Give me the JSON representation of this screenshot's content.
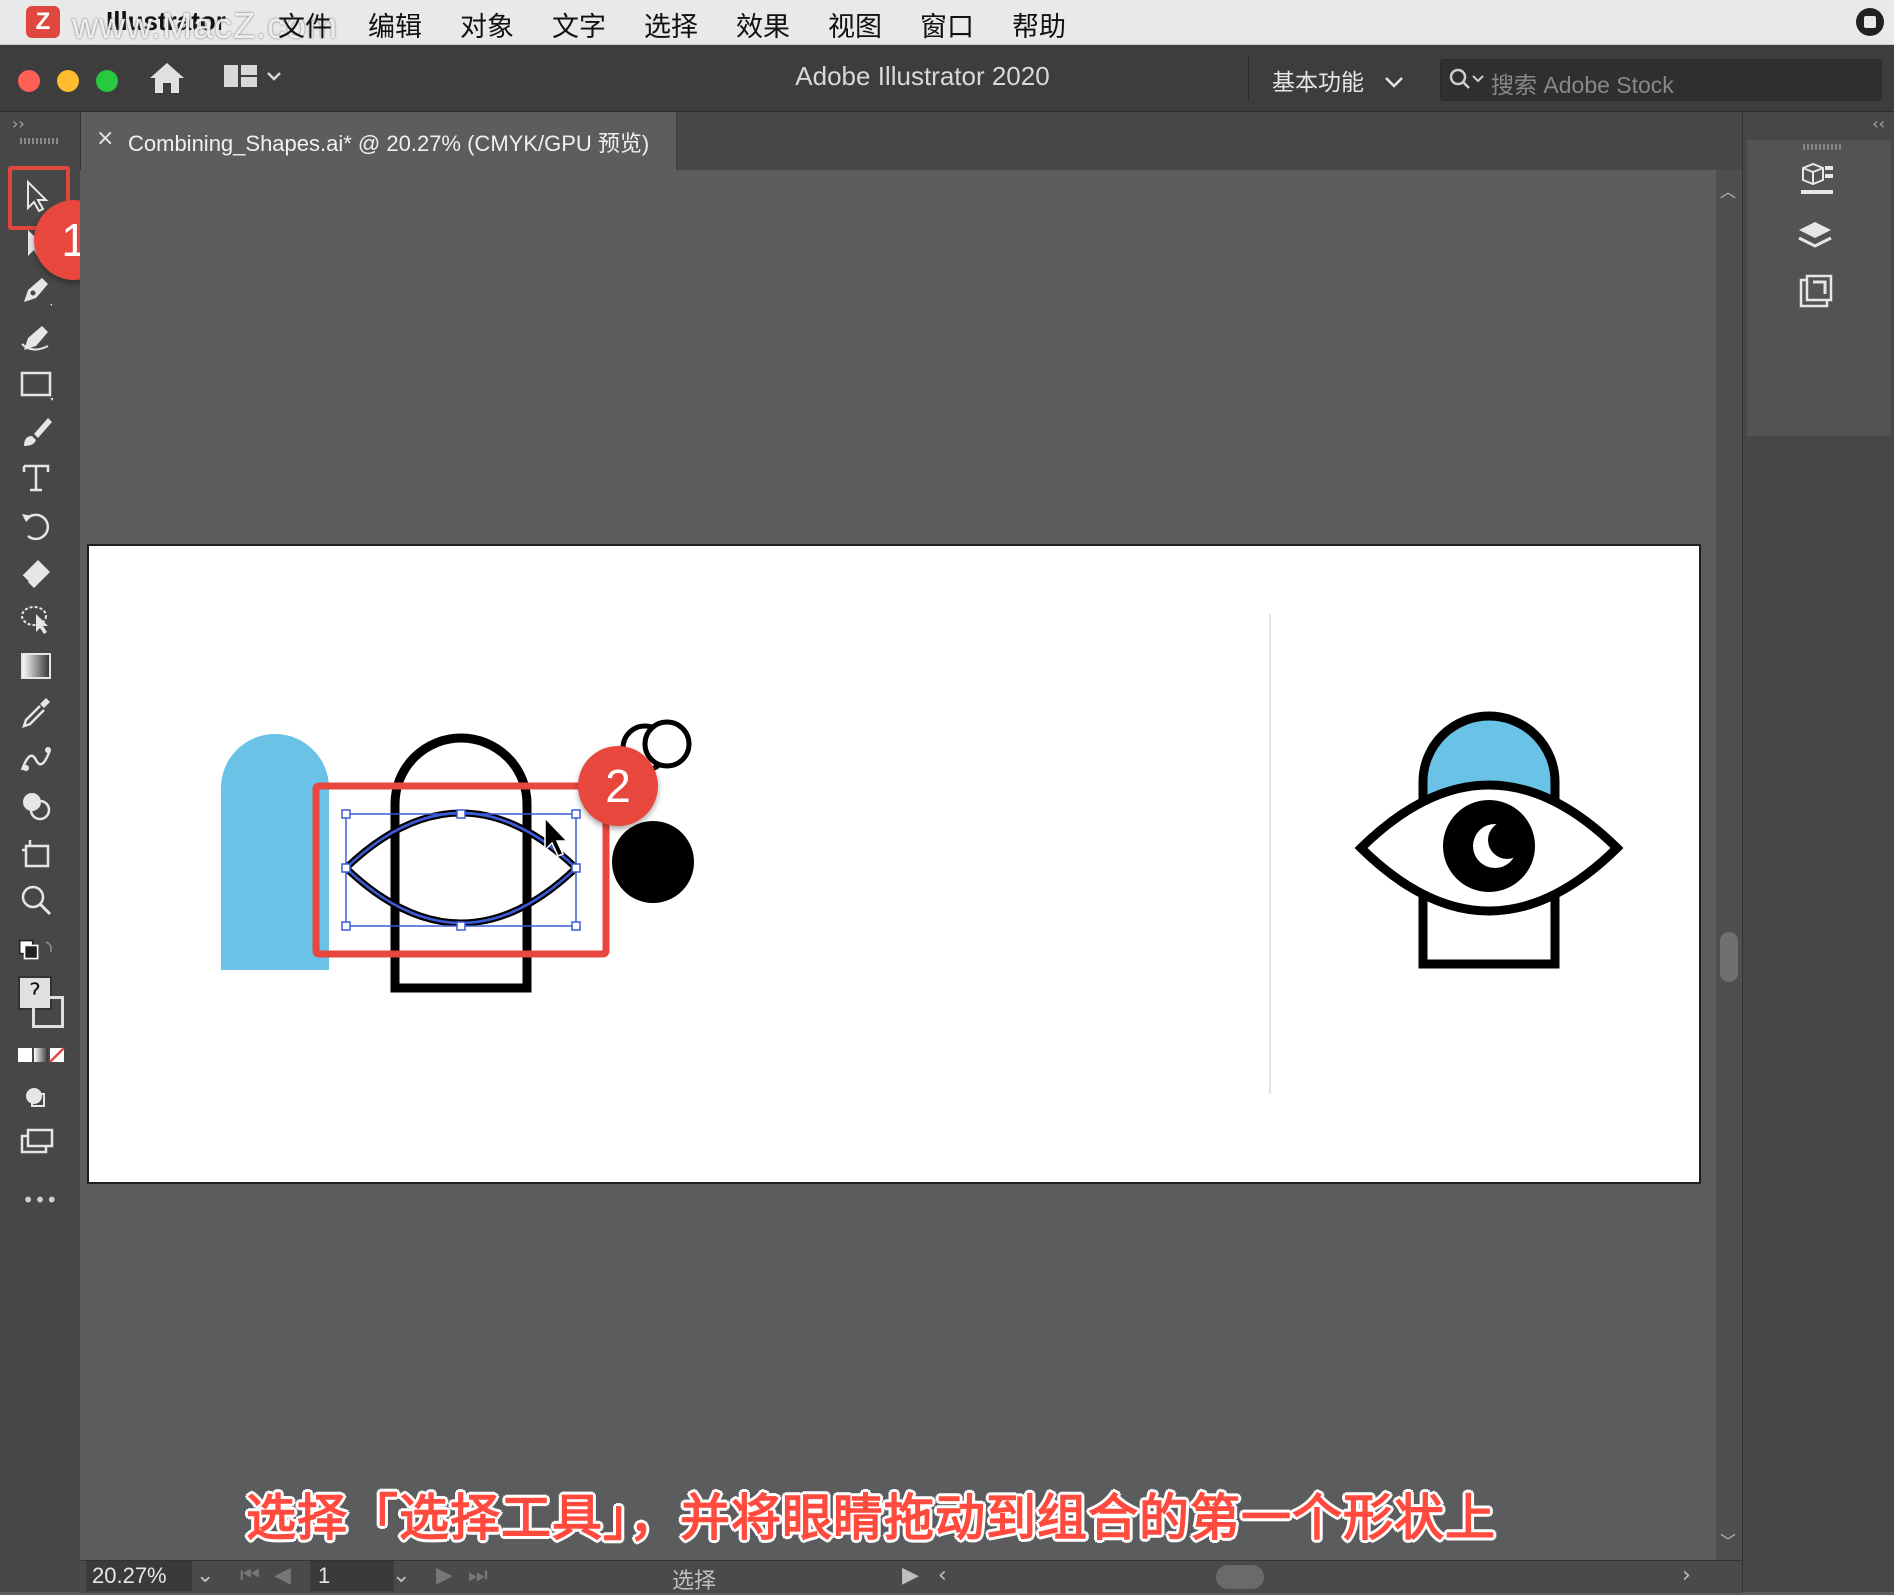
{
  "menubar": {
    "logo_letter": "Z",
    "app_name": "Illustrator",
    "watermark": "www.MacZ.com",
    "items": [
      "文件",
      "编辑",
      "对象",
      "文字",
      "选择",
      "效果",
      "视图",
      "窗口",
      "帮助"
    ]
  },
  "titlebar": {
    "title": "Adobe Illustrator 2020",
    "workspace": "基本功能",
    "search_placeholder": "搜索 Adobe Stock"
  },
  "document_tab": {
    "close_glyph": "×",
    "label": "Combining_Shapes.ai* @ 20.27% (CMYK/GPU 预览)"
  },
  "tools": [
    {
      "name": "selection-tool-icon"
    },
    {
      "name": "direct-selection-tool-icon"
    },
    {
      "name": "pen-tool-icon"
    },
    {
      "name": "curvature-tool-icon"
    },
    {
      "name": "rectangle-tool-icon"
    },
    {
      "name": "paintbrush-tool-icon"
    },
    {
      "name": "type-tool-icon"
    },
    {
      "name": "rotate-tool-icon"
    },
    {
      "name": "eraser-tool-icon"
    },
    {
      "name": "free-transform-tool-icon"
    },
    {
      "name": "gradient-tool-icon"
    },
    {
      "name": "eyedropper-tool-icon"
    },
    {
      "name": "blend-tool-icon"
    },
    {
      "name": "shape-builder-tool-icon"
    },
    {
      "name": "artboard-tool-icon"
    },
    {
      "name": "zoom-tool-icon"
    }
  ],
  "fill_stroke": {
    "unknown_glyph": "?"
  },
  "more_tools": "•••",
  "callouts": {
    "one": "1",
    "two": "2"
  },
  "status": {
    "zoom": "20.27%",
    "page": "1",
    "tool_name": "选择"
  },
  "caption": "选择「选择工具」，并将眼睛拖动到组合的第一个形状上",
  "colors": {
    "accent_red": "#e8473d",
    "artwork_blue": "#6ac3e6",
    "selection_blue": "#3b5bd9"
  }
}
